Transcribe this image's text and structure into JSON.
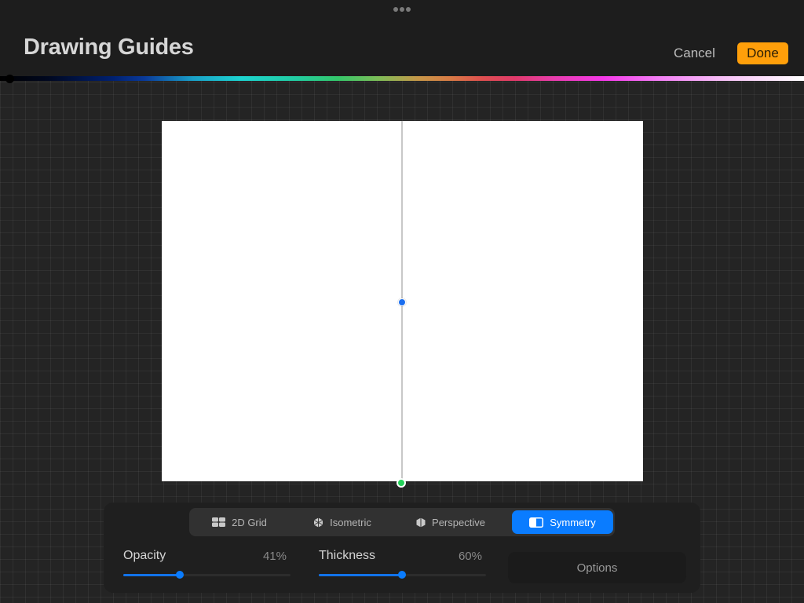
{
  "header": {
    "title": "Drawing Guides",
    "cancel_label": "Cancel",
    "done_label": "Done",
    "more_icon": "ellipsis-icon"
  },
  "colors": {
    "accent": "#0a7cff",
    "done_button": "#ff9f0a",
    "center_handle": "#1a6ef0",
    "rotate_handle": "#22d158",
    "guide_line": "#c8c8c8"
  },
  "guide_modes": {
    "selected": "Symmetry",
    "tabs": [
      {
        "label": "2D Grid",
        "icon": "grid-icon"
      },
      {
        "label": "Isometric",
        "icon": "isometric-cube-icon"
      },
      {
        "label": "Perspective",
        "icon": "perspective-icon"
      },
      {
        "label": "Symmetry",
        "icon": "symmetry-icon"
      }
    ]
  },
  "controls": {
    "opacity": {
      "label": "Opacity",
      "value_text": "41%",
      "value": 41
    },
    "thickness": {
      "label": "Thickness",
      "value_text": "60%",
      "value": 60
    },
    "options_label": "Options"
  }
}
